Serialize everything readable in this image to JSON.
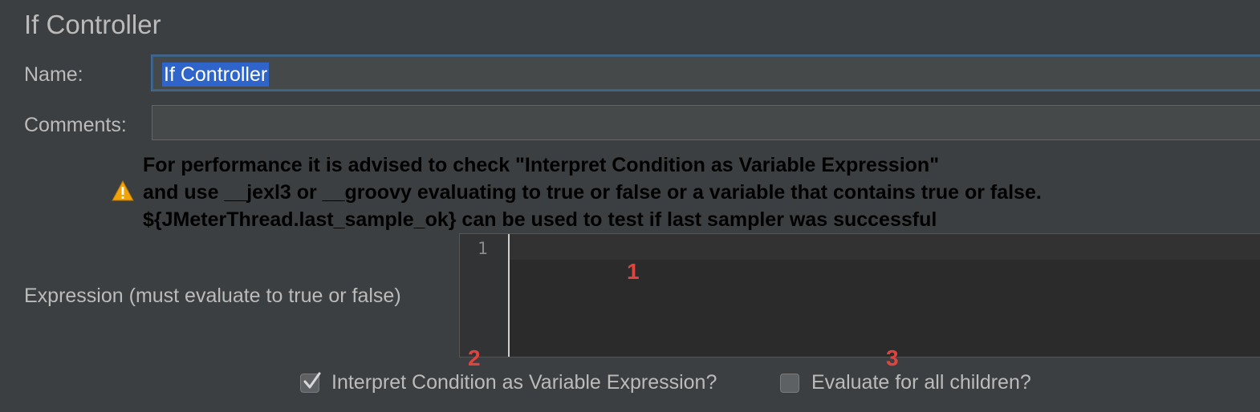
{
  "page_title": "If Controller",
  "name_field": {
    "label": "Name:",
    "value": "If Controller"
  },
  "comments_field": {
    "label": "Comments:",
    "value": ""
  },
  "warning": {
    "icon": "warning-triangle-icon",
    "lines": [
      "For performance it is advised to check \"Interpret Condition as Variable Expression\"",
      "and use __jexl3 or __groovy evaluating to true or false or a variable that contains true or false.",
      "${JMeterThread.last_sample_ok} can be used to test if last sampler was successful"
    ]
  },
  "expression": {
    "label": "Expression (must evaluate to true or false)",
    "line_number": "1",
    "value": ""
  },
  "annotations": {
    "marker_1": "1",
    "marker_2": "2",
    "marker_3": "3"
  },
  "options": {
    "interpret_condition": {
      "label": "Interpret Condition as Variable Expression?",
      "checked": true
    },
    "evaluate_all_children": {
      "label": "Evaluate for all children?",
      "checked": false
    }
  },
  "colors": {
    "background": "#3c3f41",
    "text": "#bbbbbb",
    "selection": "#2f65ca",
    "annotation": "#e0443e",
    "warning_icon": "#f0a30a"
  }
}
